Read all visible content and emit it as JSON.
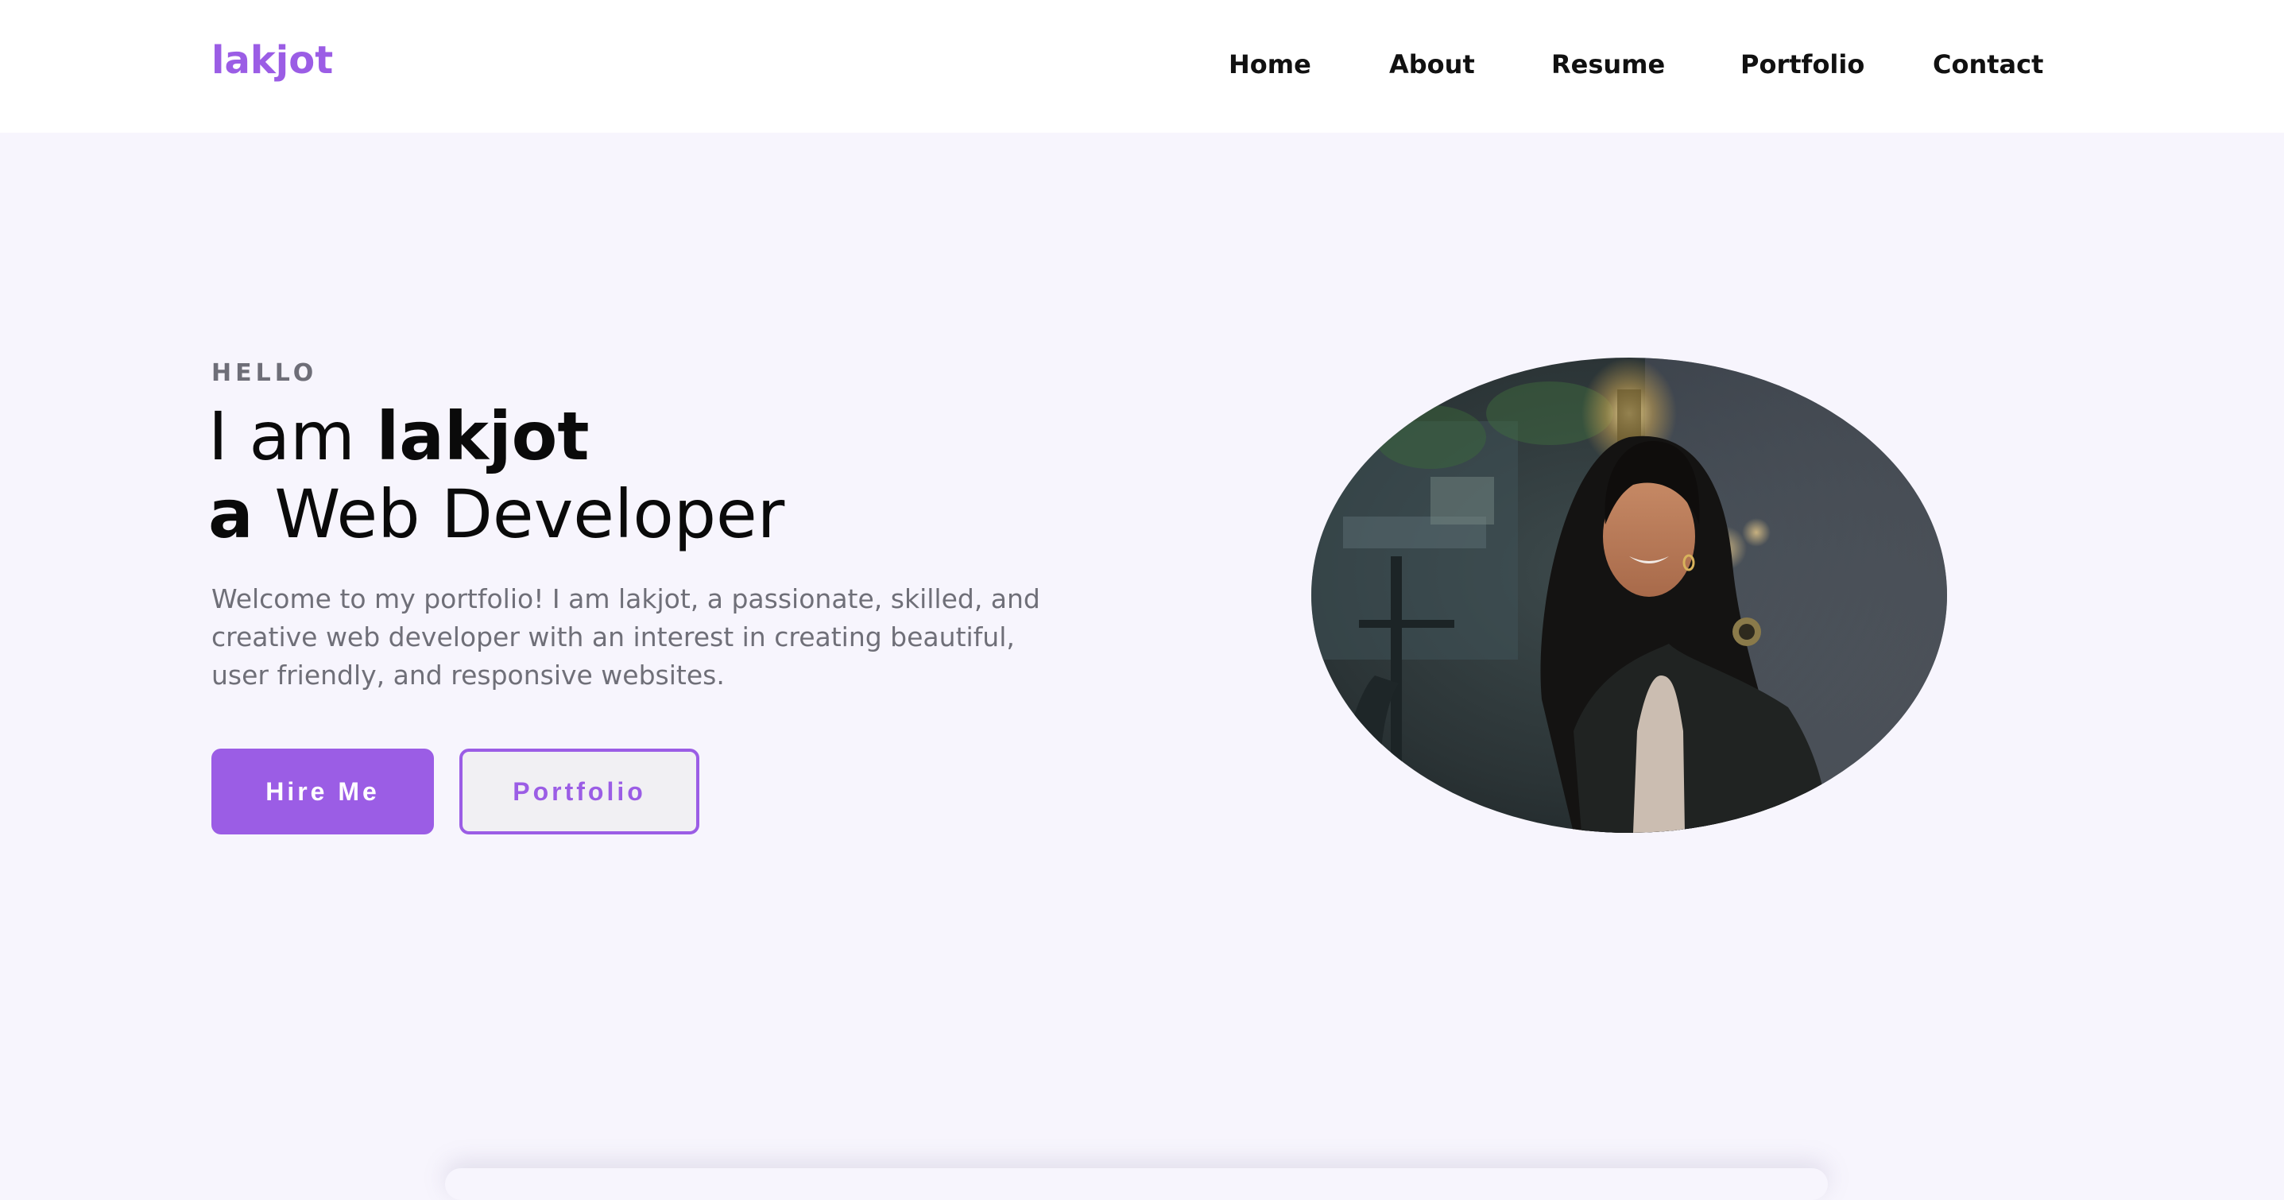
{
  "header": {
    "logo": "lakjot",
    "nav": [
      {
        "label": "Home"
      },
      {
        "label": "About"
      },
      {
        "label": "Resume"
      },
      {
        "label": "Portfolio"
      },
      {
        "label": "Contact"
      }
    ]
  },
  "hero": {
    "eyebrow": "HELLO",
    "line1_prefix": "I am ",
    "line1_name": "lakjot",
    "line2_prefix": "a",
    "line2_rest": " Web Developer",
    "description": "Welcome to my portfolio! I am lakjot, a passionate, skilled, and creative web developer with an interest in creating beautiful, user friendly, and responsive websites.",
    "buttons": {
      "hire": "Hire Me",
      "portfolio": "Portfolio"
    }
  },
  "colors": {
    "accent": "#9b5de5",
    "page_bg": "#f7f5fd",
    "nav_bg": "#ffffff",
    "text_dark": "#0a0a0a",
    "text_muted": "#6f6f78"
  }
}
